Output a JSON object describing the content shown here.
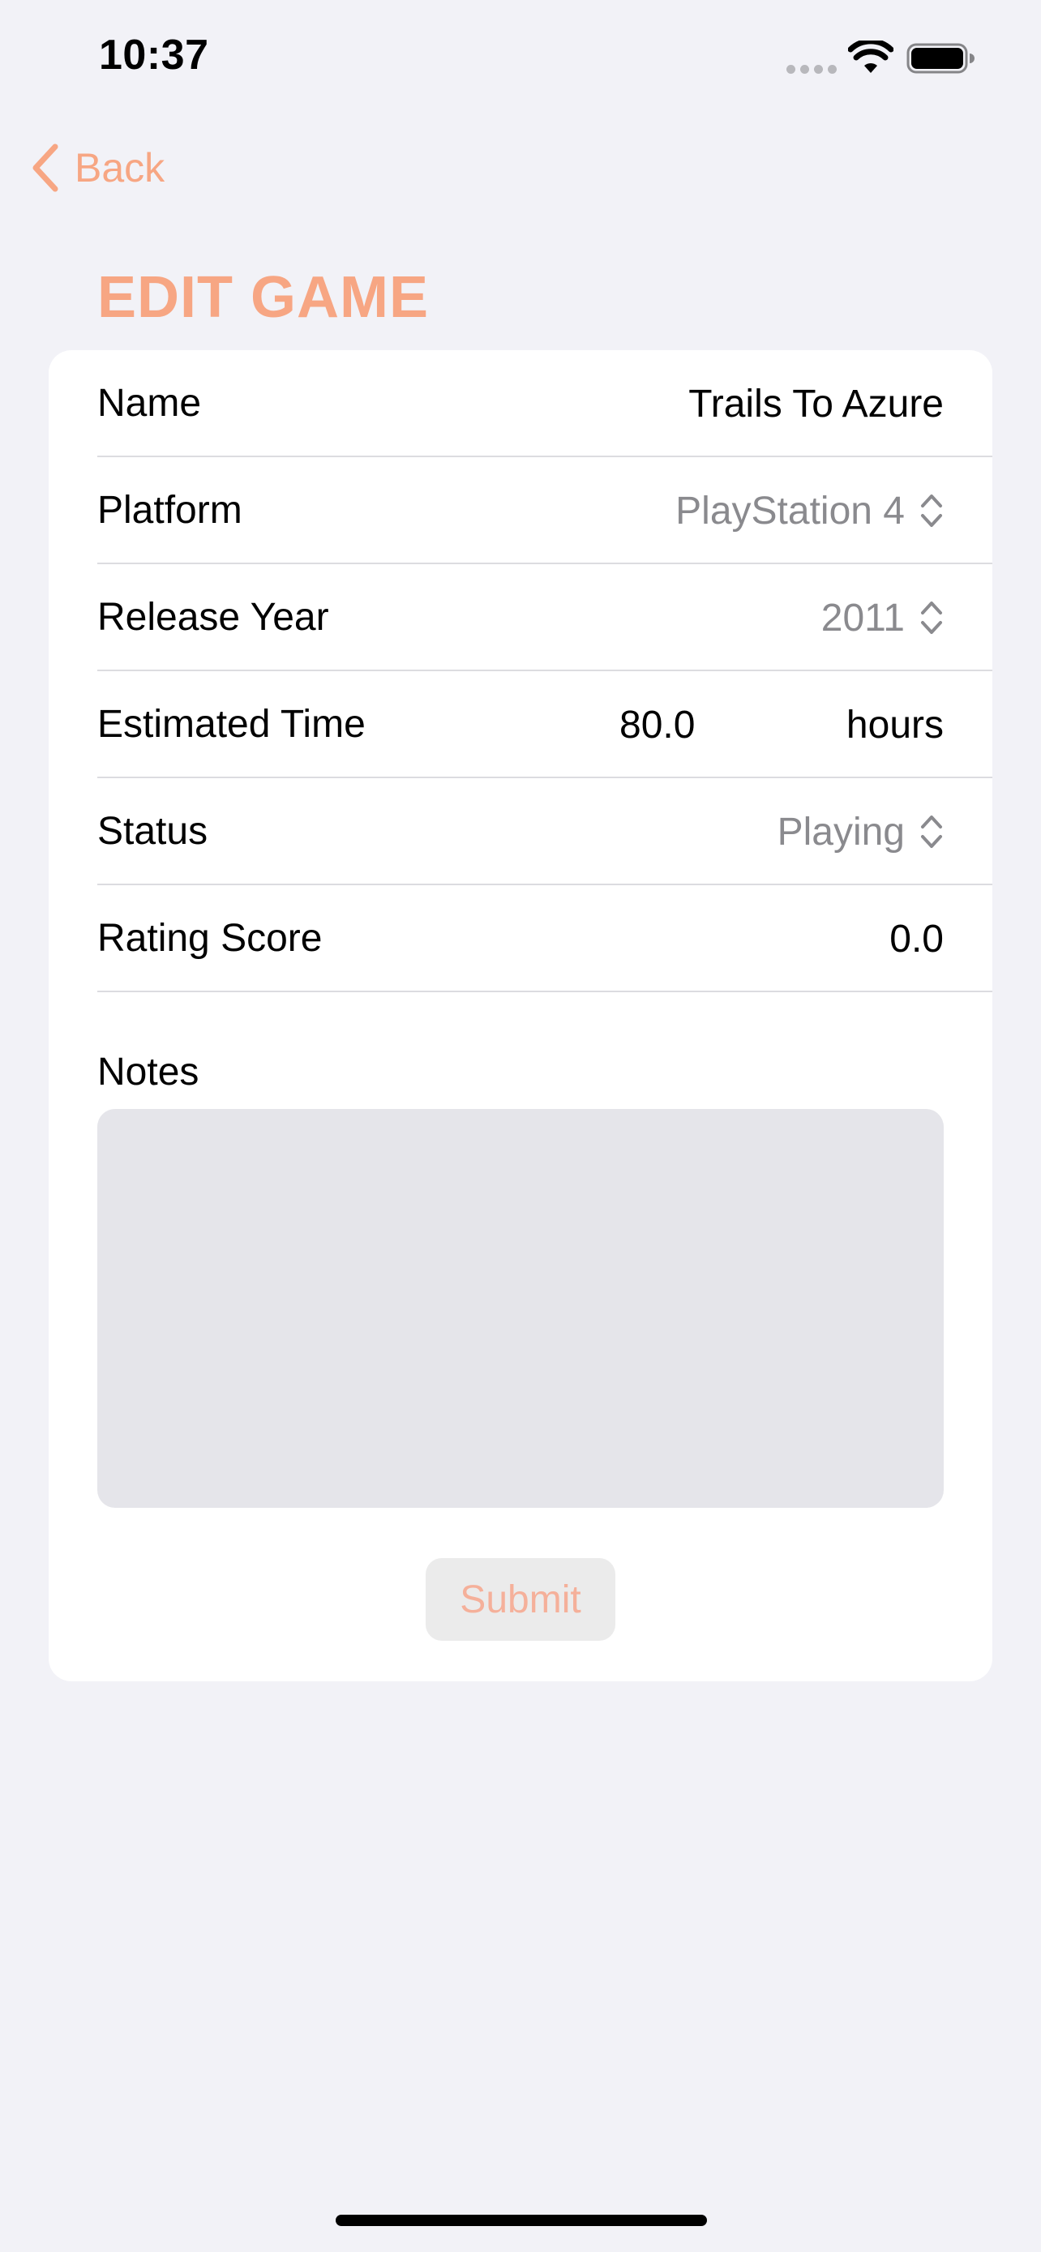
{
  "status_bar": {
    "time": "10:37"
  },
  "nav": {
    "back_label": "Back"
  },
  "page": {
    "title": "EDIT GAME"
  },
  "form": {
    "rows": [
      {
        "label": "Name",
        "value": "Trails To Azure"
      },
      {
        "label": "Platform",
        "value": "PlayStation 4"
      },
      {
        "label": "Release Year",
        "value": "2011"
      },
      {
        "label": "Estimated Time",
        "value": "80.0",
        "unit": "hours"
      },
      {
        "label": "Status",
        "value": "Playing"
      },
      {
        "label": "Rating Score",
        "value": "0.0"
      }
    ],
    "notes_label": "Notes",
    "notes_value": "",
    "submit_label": "Submit"
  },
  "colors": {
    "accent": "#F7A683",
    "background": "#F2F2F7",
    "card": "#FFFFFF",
    "secondary_text": "#8A8A8E",
    "notes_field": "#E5E5EA"
  },
  "icons": [
    "signal-icon",
    "wifi-icon",
    "battery-icon",
    "chevron-left-icon",
    "chevron-up-down-icon"
  ]
}
